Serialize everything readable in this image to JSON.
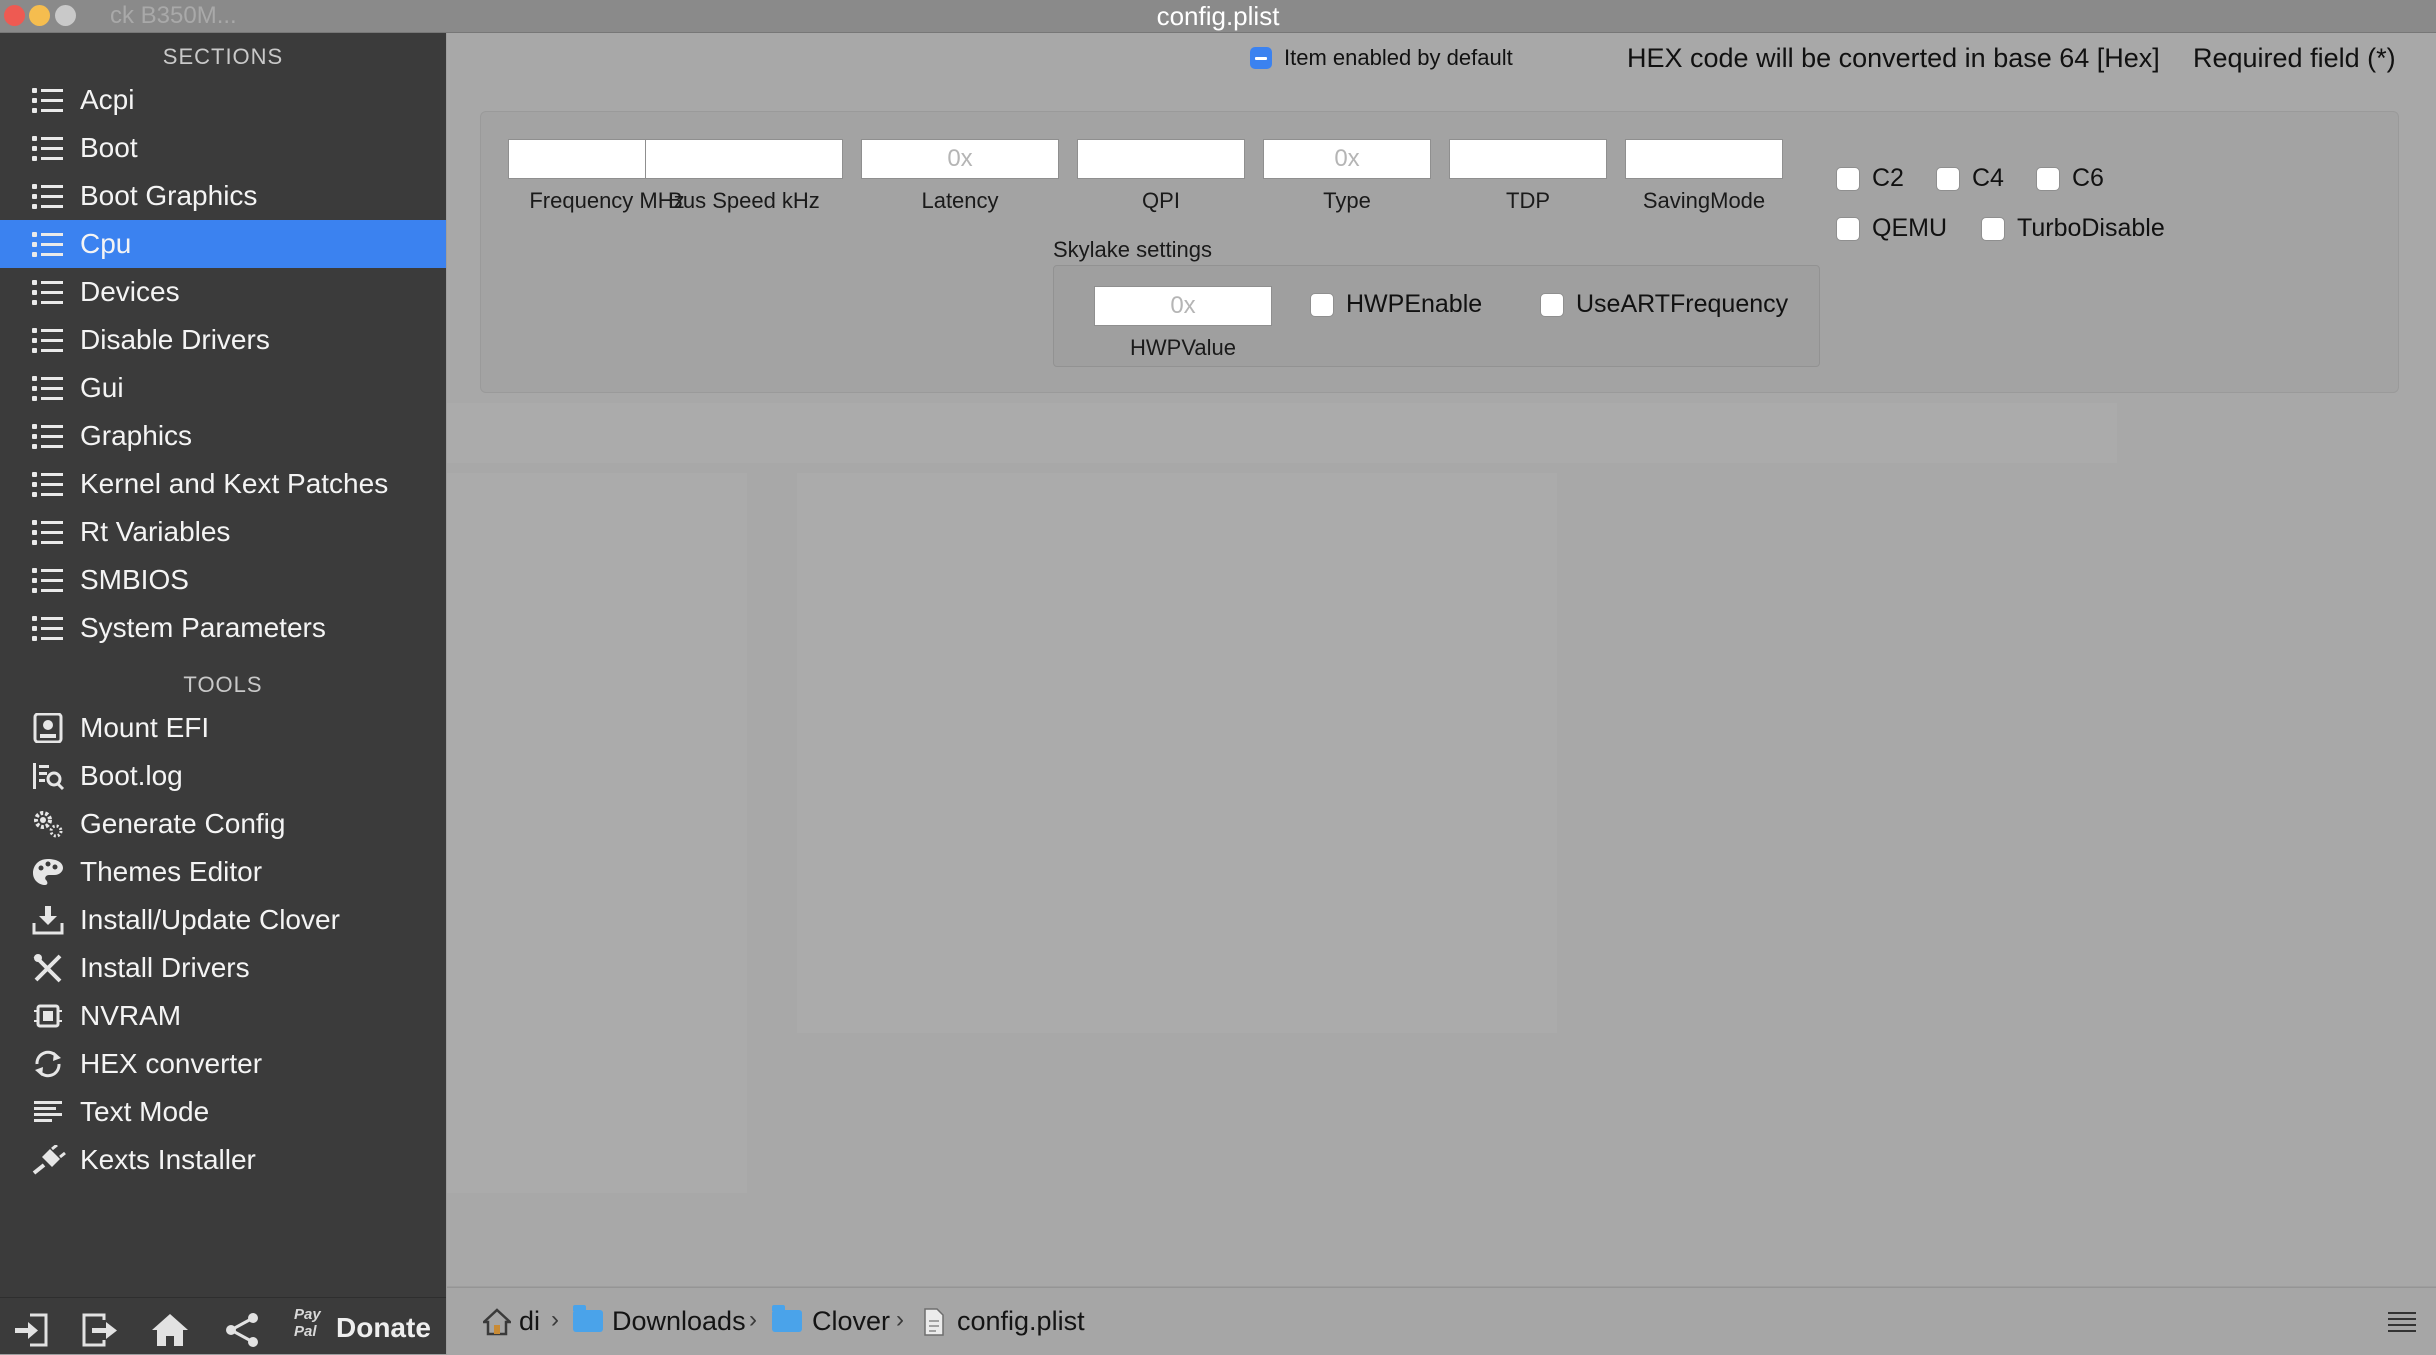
{
  "window": {
    "title": "config.plist",
    "ghost_title": "ck B350M...",
    "traffic_colors": [
      "#ee5a52",
      "#f5bd4f",
      "#c9c9c9"
    ]
  },
  "sidebar": {
    "sections_title": "SECTIONS",
    "sections": [
      {
        "label": "Acpi"
      },
      {
        "label": "Boot"
      },
      {
        "label": "Boot Graphics"
      },
      {
        "label": "Cpu",
        "active": true
      },
      {
        "label": "Devices"
      },
      {
        "label": "Disable Drivers"
      },
      {
        "label": "Gui"
      },
      {
        "label": "Graphics"
      },
      {
        "label": "Kernel and Kext Patches"
      },
      {
        "label": "Rt Variables"
      },
      {
        "label": "SMBIOS"
      },
      {
        "label": "System Parameters"
      }
    ],
    "tools_title": "TOOLS",
    "tools": [
      {
        "label": "Mount EFI",
        "icon": "disk-icon"
      },
      {
        "label": "Boot.log",
        "icon": "log-search-icon"
      },
      {
        "label": "Generate Config",
        "icon": "gears-icon"
      },
      {
        "label": "Themes Editor",
        "icon": "palette-icon"
      },
      {
        "label": "Install/Update Clover",
        "icon": "download-icon"
      },
      {
        "label": "Install Drivers",
        "icon": "tools-icon"
      },
      {
        "label": "NVRAM",
        "icon": "chip-icon"
      },
      {
        "label": "HEX converter",
        "icon": "refresh-icon"
      },
      {
        "label": "Text Mode",
        "icon": "text-icon"
      },
      {
        "label": "Kexts Installer",
        "icon": "plug-icon"
      }
    ],
    "bottom": {
      "donate_label": "Donate",
      "paypal_label": "Pay Pal",
      "buttons": [
        "import-icon",
        "export-icon",
        "home-icon",
        "share-icon"
      ]
    }
  },
  "cpu": {
    "item_enabled_label": "Item enabled by default",
    "hex_note": "HEX code will be converted in base 64 [Hex]",
    "required_note": "Required field (*)",
    "fields": [
      {
        "label": "Frequency MHz",
        "value": "",
        "placeholder": ""
      },
      {
        "label": "Bus Speed kHz",
        "value": "",
        "placeholder": ""
      },
      {
        "label": "Latency",
        "value": "",
        "placeholder": "0x"
      },
      {
        "label": "QPI",
        "value": "",
        "placeholder": ""
      },
      {
        "label": "Type",
        "value": "",
        "placeholder": "0x"
      },
      {
        "label": "TDP",
        "value": "",
        "placeholder": ""
      },
      {
        "label": "SavingMode",
        "value": "",
        "placeholder": ""
      }
    ],
    "checkboxes": [
      {
        "label": "C2",
        "checked": false
      },
      {
        "label": "C4",
        "checked": false
      },
      {
        "label": "C6",
        "checked": false
      },
      {
        "label": "QEMU",
        "checked": false
      },
      {
        "label": "TurboDisable",
        "checked": false
      }
    ],
    "skylake": {
      "title": "Skylake settings",
      "hwp_value_label": "HWPValue",
      "hwp_value_placeholder": "0x",
      "hwp_enable_label": "HWPEnable",
      "use_art_label": "UseARTFrequency"
    }
  },
  "pathbar": {
    "crumbs": [
      "di",
      "Downloads",
      "Clover",
      "config.plist"
    ],
    "separator": "›"
  },
  "colors": {
    "accent": "#3b82f0",
    "sidebar_bg": "#3b3b3b",
    "main_bg": "#a8a8a8"
  }
}
